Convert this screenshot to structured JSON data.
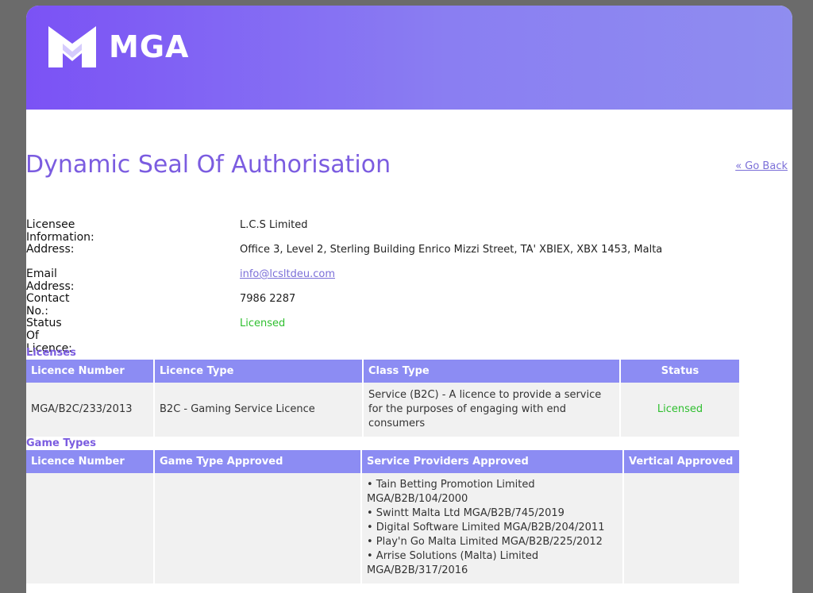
{
  "brand": {
    "name": "MGA",
    "logo_icon": "mga-logo-icon"
  },
  "page": {
    "title": "Dynamic Seal Of Authorisation",
    "go_back": "« Go Back"
  },
  "info": {
    "licensee_label": "Licensee Information:",
    "licensee_value": "L.C.S Limited",
    "address_label": "Address:",
    "address_value": "Office 3, Level 2, Sterling Building Enrico Mizzi Street, TA' XBIEX, XBX 1453, Malta",
    "email_label": "Email Address:",
    "email_value": "info@lcsltdeu.com",
    "contact_label": "Contact No.:",
    "contact_value": "7986 2287",
    "status_label": "Status Of Licence:",
    "status_value": "Licensed"
  },
  "licenses": {
    "title": "Licenses",
    "headers": [
      "Licence Number",
      "Licence Type",
      "Class Type",
      "Status"
    ],
    "rows": [
      {
        "number": "MGA/B2C/233/2013",
        "type": "B2C - Gaming Service Licence",
        "class_type": "Service (B2C) - A licence to provide a service for the purposes of engaging with end consumers",
        "status": "Licensed"
      }
    ]
  },
  "game_types": {
    "title": "Game Types",
    "headers": [
      "Licence Number",
      "Game Type Approved",
      "Service Providers Approved",
      "Vertical Approved"
    ],
    "rows": [
      {
        "number": "",
        "game_type": "",
        "providers": [
          "• Tain Betting Promotion Limited MGA/B2B/104/2000",
          "• Swintt Malta Ltd MGA/B2B/745/2019",
          "• Digital Software Limited MGA/B2B/204/2011",
          "• Play'n Go Malta Limited MGA/B2B/225/2012",
          "• Arrise Solutions (Malta) Limited MGA/B2B/317/2016"
        ],
        "vertical": ""
      }
    ]
  },
  "colors": {
    "accent": "#7b5ce0",
    "header_bg": "#8c8cf3",
    "status_ok": "#2fbf2f",
    "banner_start": "#7b52f5",
    "banner_end": "#8f8df0"
  }
}
